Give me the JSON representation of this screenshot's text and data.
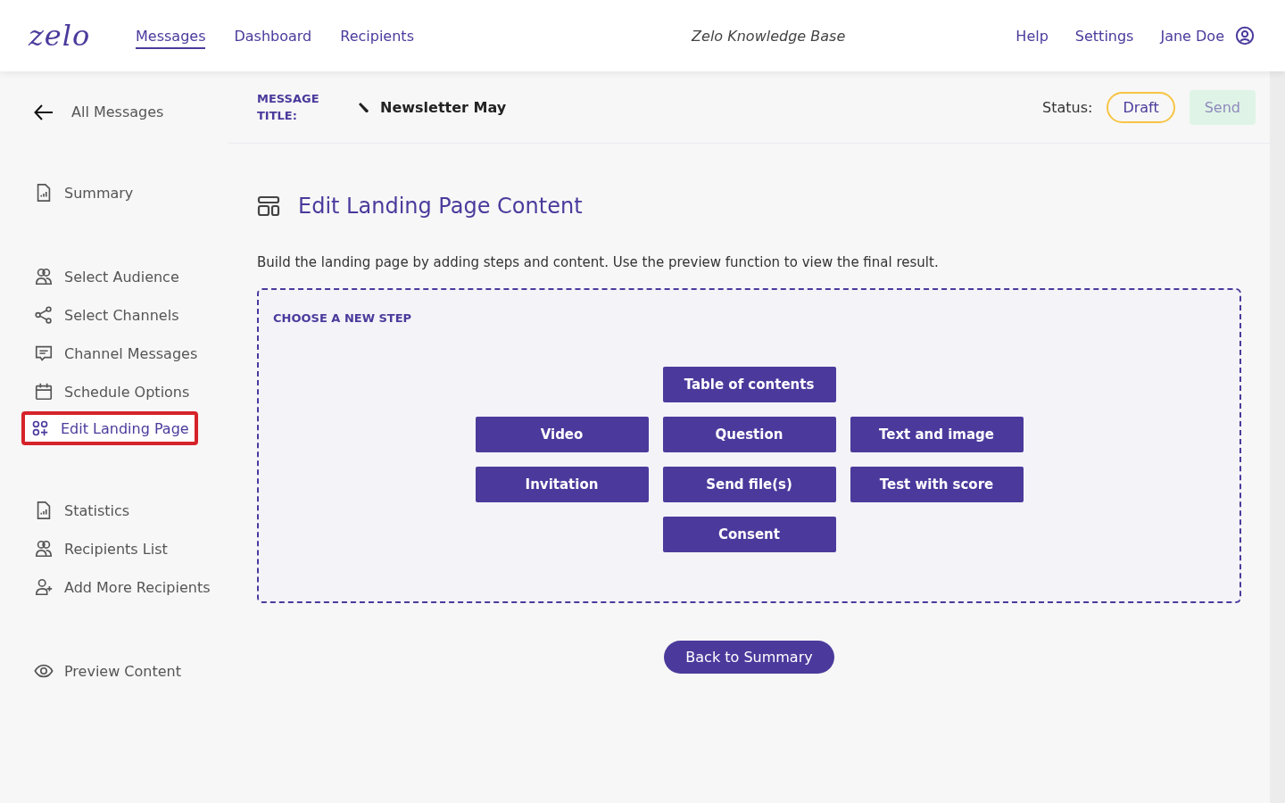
{
  "header": {
    "logo": "zelo",
    "nav": [
      {
        "label": "Messages",
        "selected": true
      },
      {
        "label": "Dashboard",
        "selected": false
      },
      {
        "label": "Recipients",
        "selected": false
      }
    ],
    "knowledge_base": "Zelo Knowledge Base",
    "links": [
      "Help",
      "Settings"
    ],
    "user": "Jane Doe"
  },
  "sidebar": {
    "back": "All Messages",
    "groups": [
      [
        {
          "label": "Summary",
          "kind": "report",
          "selected": false
        }
      ],
      [
        {
          "label": "Select Audience",
          "kind": "people",
          "selected": false
        },
        {
          "label": "Select Channels",
          "kind": "share",
          "selected": false
        },
        {
          "label": "Channel Messages",
          "kind": "message",
          "selected": false
        },
        {
          "label": "Schedule Options",
          "kind": "calendar",
          "selected": false
        },
        {
          "label": "Edit Landing Page",
          "kind": "blocks",
          "selected": true
        }
      ],
      [
        {
          "label": "Statistics",
          "kind": "report",
          "selected": false
        },
        {
          "label": "Recipients List",
          "kind": "people",
          "selected": false
        },
        {
          "label": "Add More Recipients",
          "kind": "add-person",
          "selected": false
        }
      ],
      [
        {
          "label": "Preview Content",
          "kind": "eye",
          "selected": false
        }
      ]
    ]
  },
  "message_bar": {
    "label": "MESSAGE TITLE:",
    "title": "Newsletter May",
    "status_label": "Status:",
    "status": "Draft",
    "send": {
      "label": "Send",
      "disabled": true
    }
  },
  "content": {
    "heading": "Edit Landing Page Content",
    "description": "Build the landing page by adding steps and content. Use the preview function to view the final result.",
    "chooser_title": "CHOOSE A NEW STEP",
    "step_rows": [
      [
        "Table of contents"
      ],
      [
        "Video",
        "Question",
        "Text and image"
      ],
      [
        "Invitation",
        "Send file(s)",
        "Test with score"
      ],
      [
        "Consent"
      ]
    ],
    "back_button": "Back to Summary"
  }
}
